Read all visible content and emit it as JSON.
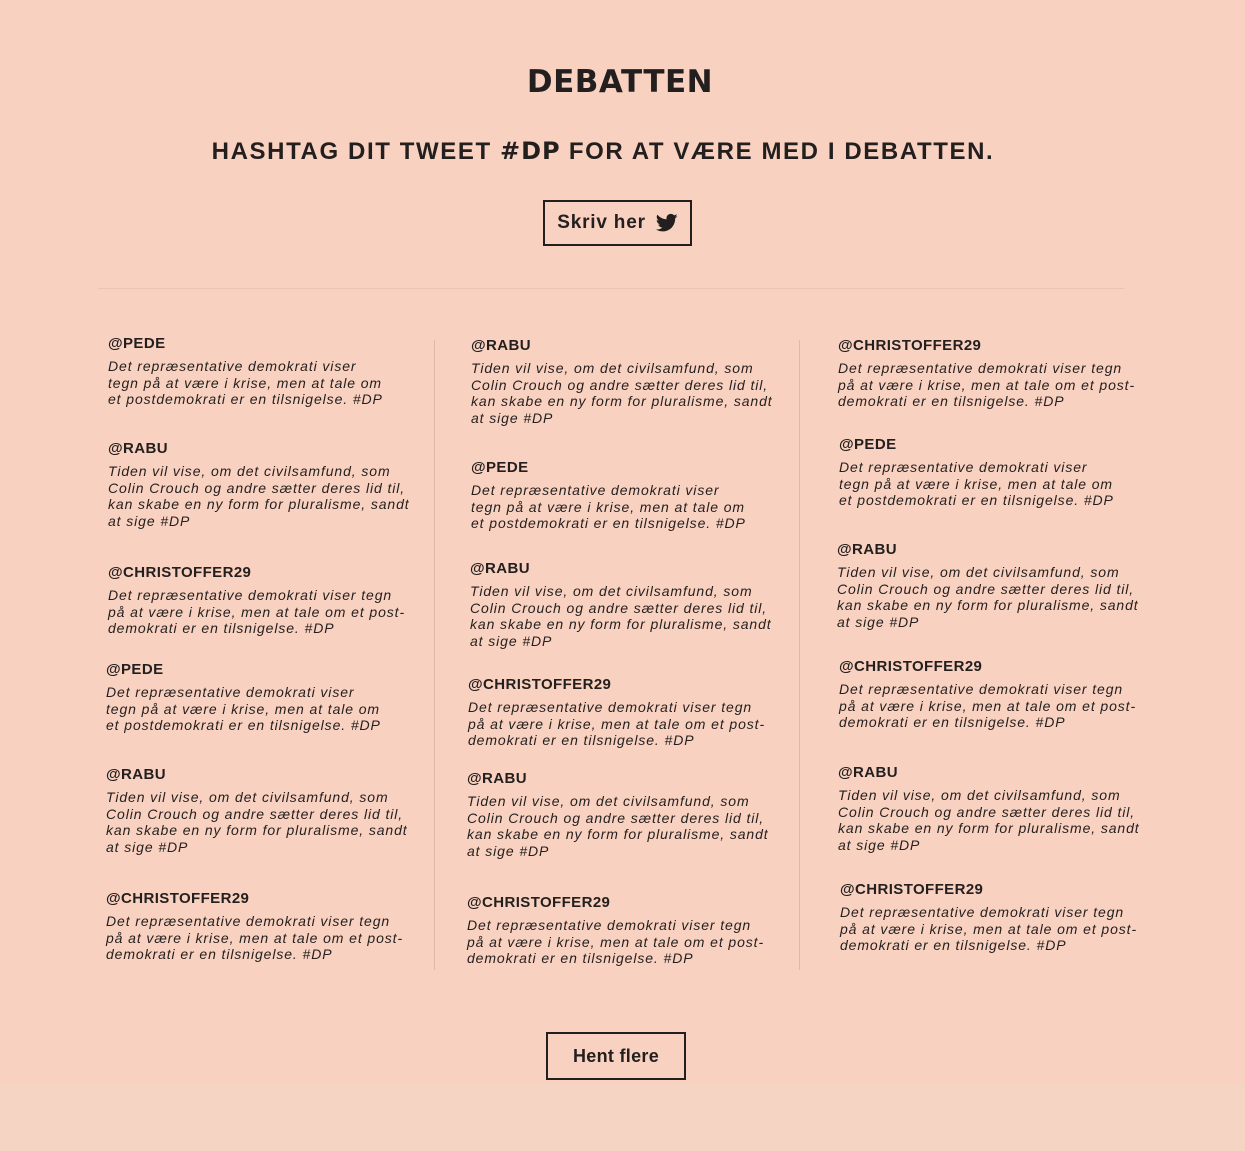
{
  "header": {
    "title": "DEBATTEN",
    "subtitle_before": "HASHTAG DIT TWEET ",
    "subtitle_hashtag": "#DP",
    "subtitle_after": " FOR AT VÆRE MED I DEBATTEN.",
    "write_button_label": "Skriv her",
    "write_button_icon": "twitter-bird-icon"
  },
  "feed": {
    "columns": [
      [
        {
          "handle": "@PEDE",
          "text": "Det repræsentative demokrati viser\ntegn på at være i krise, men at tale om\net postdemokrati er en tilsnigelse. #DP"
        },
        {
          "handle": "@RABU",
          "text": "Tiden vil vise, om det civilsamfund, som\nColin Crouch og andre sætter deres lid til,\nkan skabe en ny form for pluralisme, sandt\nat sige #DP"
        },
        {
          "handle": "@CHRISTOFFER29",
          "text": "Det repræsentative demokrati viser tegn\npå at være i krise, men at tale om et post-\ndemokrati er en tilsnigelse. #DP"
        },
        {
          "handle": "@PEDE",
          "text": "Det repræsentative demokrati viser\ntegn på at være i krise, men at tale om\net postdemokrati er en tilsnigelse. #DP"
        },
        {
          "handle": "@RABU",
          "text": "Tiden vil vise, om det civilsamfund, som\nColin Crouch og andre sætter deres lid til,\nkan skabe en ny form for pluralisme, sandt\nat sige #DP"
        },
        {
          "handle": "@CHRISTOFFER29",
          "text": "Det repræsentative demokrati viser tegn\npå at være i krise, men at tale om et post-\ndemokrati er en tilsnigelse. #DP"
        }
      ],
      [
        {
          "handle": "@RABU",
          "text": "Tiden vil vise, om det civilsamfund, som\nColin Crouch og andre sætter deres lid til,\nkan skabe en ny form for pluralisme, sandt\nat sige #DP"
        },
        {
          "handle": "@PEDE",
          "text": "Det repræsentative demokrati viser\ntegn på at være i krise, men at tale om\net postdemokrati er en tilsnigelse. #DP"
        },
        {
          "handle": "@RABU",
          "text": "Tiden vil vise, om det civilsamfund, som\nColin Crouch og andre sætter deres lid til,\nkan skabe en ny form for pluralisme, sandt\nat sige #DP"
        },
        {
          "handle": "@CHRISTOFFER29",
          "text": "Det repræsentative demokrati viser tegn\npå at være i krise, men at tale om et post-\ndemokrati er en tilsnigelse. #DP"
        },
        {
          "handle": "@RABU",
          "text": "Tiden vil vise, om det civilsamfund, som\nColin Crouch og andre sætter deres lid til,\nkan skabe en ny form for pluralisme, sandt\nat sige #DP"
        },
        {
          "handle": "@CHRISTOFFER29",
          "text": "Det repræsentative demokrati viser tegn\npå at være i krise, men at tale om et post-\ndemokrati er en tilsnigelse. #DP"
        }
      ],
      [
        {
          "handle": "@CHRISTOFFER29",
          "text": "Det repræsentative demokrati viser tegn\npå at være i krise, men at tale om et post-\ndemokrati er en tilsnigelse. #DP"
        },
        {
          "handle": "@PEDE",
          "text": "Det repræsentative demokrati viser\ntegn på at være i krise, men at tale om\net postdemokrati er en tilsnigelse. #DP"
        },
        {
          "handle": "@RABU",
          "text": "Tiden vil vise, om det civilsamfund, som\nColin Crouch og andre sætter deres lid til,\nkan skabe en ny form for pluralisme, sandt\nat sige #DP"
        },
        {
          "handle": "@CHRISTOFFER29",
          "text": "Det repræsentative demokrati viser tegn\npå at være i krise, men at tale om et post-\ndemokrati er en tilsnigelse. #DP"
        },
        {
          "handle": "@RABU",
          "text": "Tiden vil vise, om det civilsamfund, som\nColin Crouch og andre sætter deres lid til,\nkan skabe en ny form for pluralisme, sandt\nat sige #DP"
        },
        {
          "handle": "@CHRISTOFFER29",
          "text": "Det repræsentative demokrati viser tegn\npå at være i krise, men at tale om et post-\ndemokrati er en tilsnigelse. #DP"
        }
      ]
    ],
    "load_more_label": "Hent flere"
  },
  "colors": {
    "background": "#f9d1c0",
    "footer_background": "#f6d4c4",
    "text": "#231f1e"
  }
}
